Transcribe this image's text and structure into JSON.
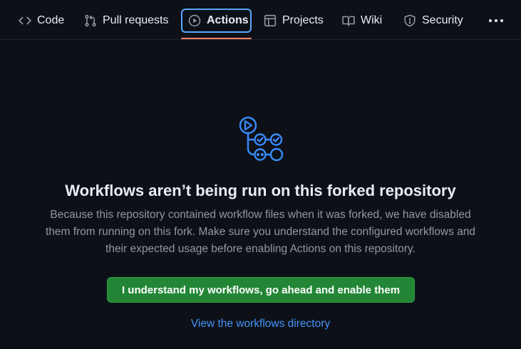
{
  "nav": {
    "tabs": [
      {
        "label": "Code",
        "icon": "code-icon"
      },
      {
        "label": "Pull requests",
        "icon": "git-pull-request-icon"
      },
      {
        "label": "Actions",
        "icon": "play-icon",
        "active": true
      },
      {
        "label": "Projects",
        "icon": "table-icon"
      },
      {
        "label": "Wiki",
        "icon": "book-icon"
      },
      {
        "label": "Security",
        "icon": "shield-icon"
      }
    ],
    "more_icon": "kebab-horizontal-icon"
  },
  "main": {
    "icon": "workflow-icon",
    "headline": "Workflows aren’t being run on this forked repository",
    "description": "Because this repository contained workflow files when it was forked, we have disabled them from running on this fork. Make sure you understand the configured workflows and their expected usage before enabling Actions on this repository.",
    "enable_button_label": "I understand my workflows, go ahead and enable them",
    "workflows_link_label": "View the workflows directory"
  },
  "colors": {
    "background": "#0d1117",
    "accent_blue": "#58a6ff",
    "active_underline": "#f78166",
    "button_green": "#238636",
    "link_blue": "#4493f8",
    "muted_text": "#9198a1"
  }
}
